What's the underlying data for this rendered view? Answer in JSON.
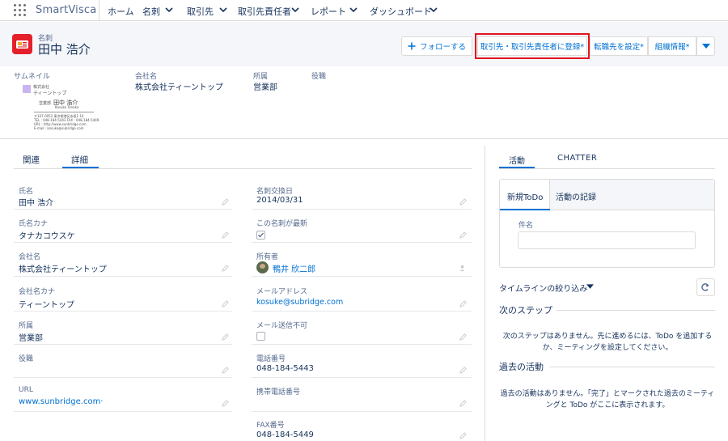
{
  "nav": {
    "app_name": "SmartVisca",
    "items": [
      {
        "label": "ホーム",
        "dropdown": false
      },
      {
        "label": "名刺",
        "dropdown": true
      },
      {
        "label": "取引先",
        "dropdown": true
      },
      {
        "label": "取引先責任者",
        "dropdown": true
      },
      {
        "label": "レポート",
        "dropdown": true
      },
      {
        "label": "ダッシュボード",
        "dropdown": true
      }
    ]
  },
  "header": {
    "object_label": "名刺",
    "record_title": "田中 浩介",
    "buttons": {
      "follow": "フォローする",
      "register": "取引先・取引先責任者に登録*",
      "transfer": "転職先を設定*",
      "org_info": "組織情報*"
    }
  },
  "highlights": {
    "thumbnail_label": "サムネイル",
    "company_label": "会社名",
    "company_value": "株式会社ティーントップ",
    "dept_label": "所属",
    "dept_value": "営業部",
    "title_label": "役職",
    "card": {
      "company_small": "株式会社",
      "company": "ティーントップ",
      "role": "営業部",
      "name": "田中 浩介",
      "name_en": "Kosuke Tanaka",
      "line1": "〒107-0052 東京都港区赤坂1-14",
      "line2": "TEL : 048-184-5443  FAX : 048-184-5449",
      "line3": "URL : http://www.sunbridge.com",
      "line4": "E-mail : kosuke@subridge.com"
    }
  },
  "tabs": {
    "related": "関連",
    "details": "詳細"
  },
  "fields_left": [
    {
      "label": "氏名",
      "value": "田中 浩介",
      "link": false
    },
    {
      "label": "氏名カナ",
      "value": "タナカコウスケ",
      "link": false
    },
    {
      "label": "会社名",
      "value": "株式会社ティーントップ",
      "link": false
    },
    {
      "label": "会社名カナ",
      "value": "ティーントップ",
      "link": false
    },
    {
      "label": "所属",
      "value": "営業部",
      "link": false
    },
    {
      "label": "役職",
      "value": "",
      "link": false
    },
    {
      "label": "URL",
      "value": "www.sunbridge.com·",
      "link": true
    }
  ],
  "fields_right": [
    {
      "label": "名刺交換日",
      "value": "2014/03/31"
    },
    {
      "label": "この名刺が最新",
      "checked": true
    },
    {
      "label": "所有者",
      "value": "鴨井 欣二郎"
    },
    {
      "label": "メールアドレス",
      "value": "kosuke@subridge.com"
    },
    {
      "label": "メール送信不可",
      "checked": false
    },
    {
      "label": "電話番号",
      "value": "048-184-5443"
    },
    {
      "label": "携帯電話番号",
      "value": ""
    },
    {
      "label": "FAX番号",
      "value": "048-184-5449"
    }
  ],
  "activity": {
    "tab_activity": "活動",
    "tab_chatter": "CHATTER",
    "subtab_todo": "新規ToDo",
    "subtab_log": "活動の記録",
    "subject_label": "件名",
    "subject_value": "",
    "timeline_filter": "タイムラインの絞り込み",
    "next_steps_title": "次のステップ",
    "next_steps_empty_1": "次のステップはありません。先に進めるには、ToDo を追加する",
    "next_steps_empty_2": "か、ミーティングを設定してください。",
    "past_title": "過去の活動",
    "past_empty_1": "過去の活動はありません。「完了」とマークされた過去のミーティ",
    "past_empty_2": "ングと ToDo がここに表示されます。"
  },
  "colors": {
    "accent": "#0070d2",
    "brand_red": "#e4202a",
    "highlight_box": "#e4151f"
  }
}
